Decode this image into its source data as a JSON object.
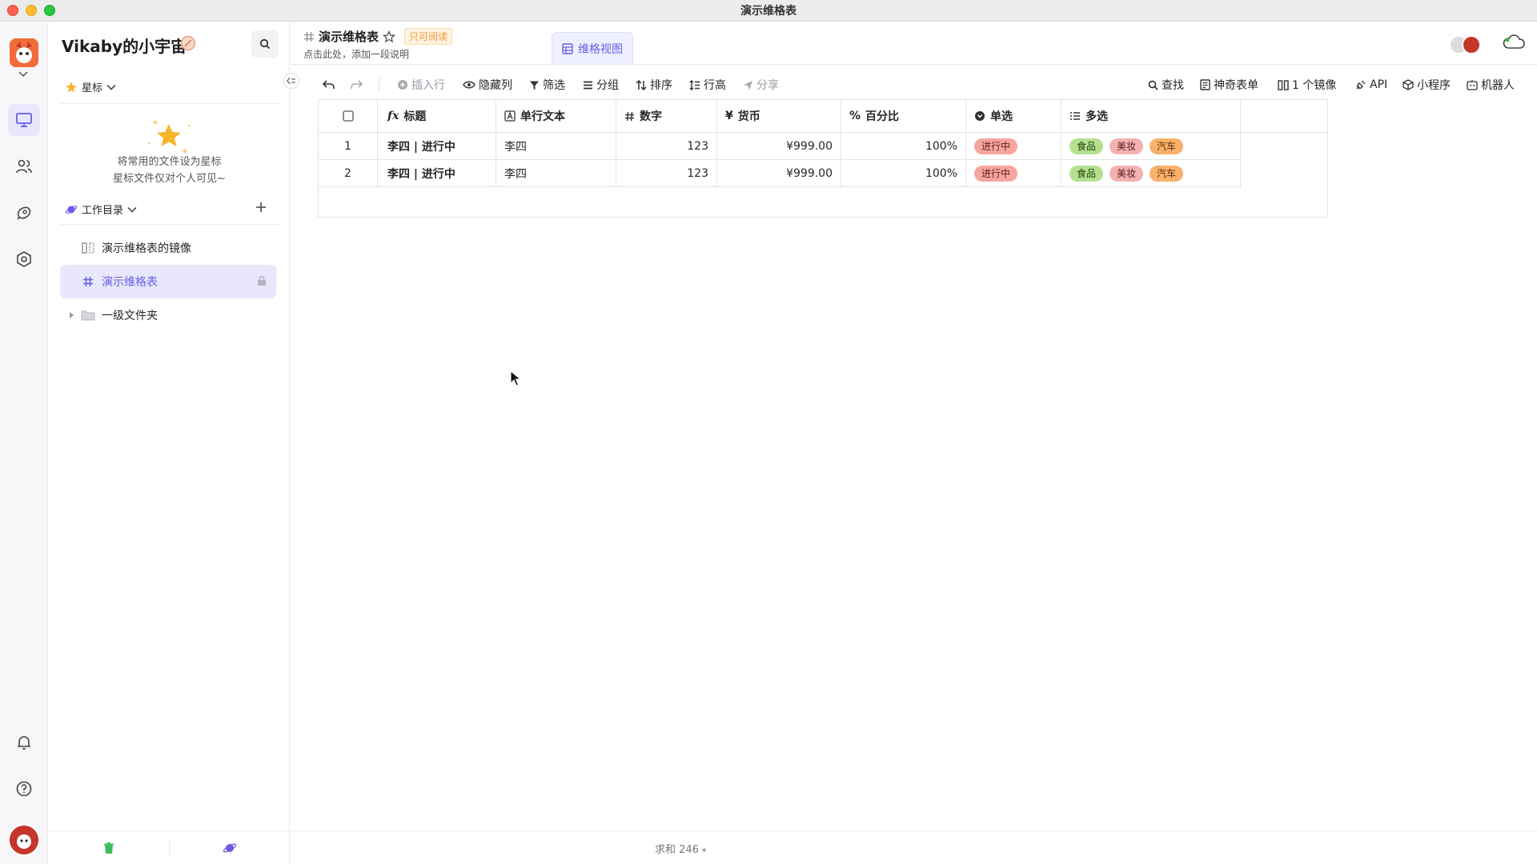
{
  "window": {
    "title": "演示维格表"
  },
  "sidebar": {
    "space_name": "Vikaby的小宇宙",
    "starred_label": "星标",
    "empty_line1": "将常用的文件设为星标",
    "empty_line2": "星标文件仅对个人可见~",
    "workdir_label": "工作目录",
    "tree": [
      {
        "label": "演示维格表的镜像",
        "icon": "mirror-icon"
      },
      {
        "label": "演示维格表",
        "icon": "datasheet-icon",
        "active": true
      },
      {
        "label": "一级文件夹",
        "icon": "folder-icon"
      }
    ]
  },
  "header": {
    "doc_title": "演示维格表",
    "readonly": "只可阅读",
    "description": "点击此处，添加一段说明",
    "view_tab": "维格视图"
  },
  "toolbar": {
    "insert_row": "插入行",
    "hide_cols": "隐藏列",
    "filter": "筛选",
    "group": "分组",
    "sort": "排序",
    "row_height": "行高",
    "share": "分享",
    "find": "查找",
    "form": "神奇表单",
    "mirror": "1 个镜像",
    "api": "API",
    "widget": "小程序",
    "robot": "机器人"
  },
  "table": {
    "columns": [
      {
        "label": "标题",
        "icon": "formula-icon"
      },
      {
        "label": "单行文本",
        "icon": "text-icon"
      },
      {
        "label": "数字",
        "icon": "number-icon"
      },
      {
        "label": "货币",
        "icon": "currency-icon"
      },
      {
        "label": "百分比",
        "icon": "percent-icon"
      },
      {
        "label": "单选",
        "icon": "single-select-icon"
      },
      {
        "label": "多选",
        "icon": "multi-select-icon"
      }
    ],
    "rows": [
      {
        "index": "1",
        "title": "李四 | 进行中",
        "text": "李四",
        "number": "123",
        "currency": "¥999.00",
        "percent": "100%",
        "single": "进行中",
        "multi": [
          "食品",
          "美妆",
          "汽车"
        ]
      },
      {
        "index": "2",
        "title": "李四 | 进行中",
        "text": "李四",
        "number": "123",
        "currency": "¥999.00",
        "percent": "100%",
        "single": "进行中",
        "multi": [
          "食品",
          "美妆",
          "汽车"
        ]
      }
    ]
  },
  "status": {
    "sum": "求和 246"
  },
  "colors": {
    "accent": "#6b5ce7",
    "tag_progress": "#f8a5a0",
    "tag_food": "#b5e08f",
    "tag_beauty": "#f4b1b1",
    "tag_car": "#f8b06b"
  }
}
